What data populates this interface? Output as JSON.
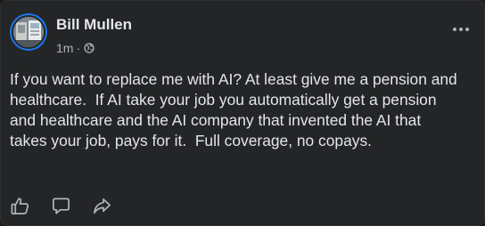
{
  "post": {
    "author": "Bill Mullen",
    "time": "1m",
    "separator": "·",
    "audience_icon": "globe-icon",
    "more_icon": "more-options-icon",
    "text": "If you want to replace me with AI? At least give me a pension and healthcare.  If AI take your job you automatically get a pension and healthcare and the AI company that invented the AI that takes your job, pays for it.  Full coverage, no copays."
  },
  "actions": [
    {
      "icon": "like-icon"
    },
    {
      "icon": "comment-icon"
    },
    {
      "icon": "share-icon"
    }
  ],
  "colors": {
    "card_background": "#242526",
    "text_primary": "#e4e6eb",
    "text_secondary": "#b0b3b8",
    "avatar_ring": "#1877f2"
  }
}
